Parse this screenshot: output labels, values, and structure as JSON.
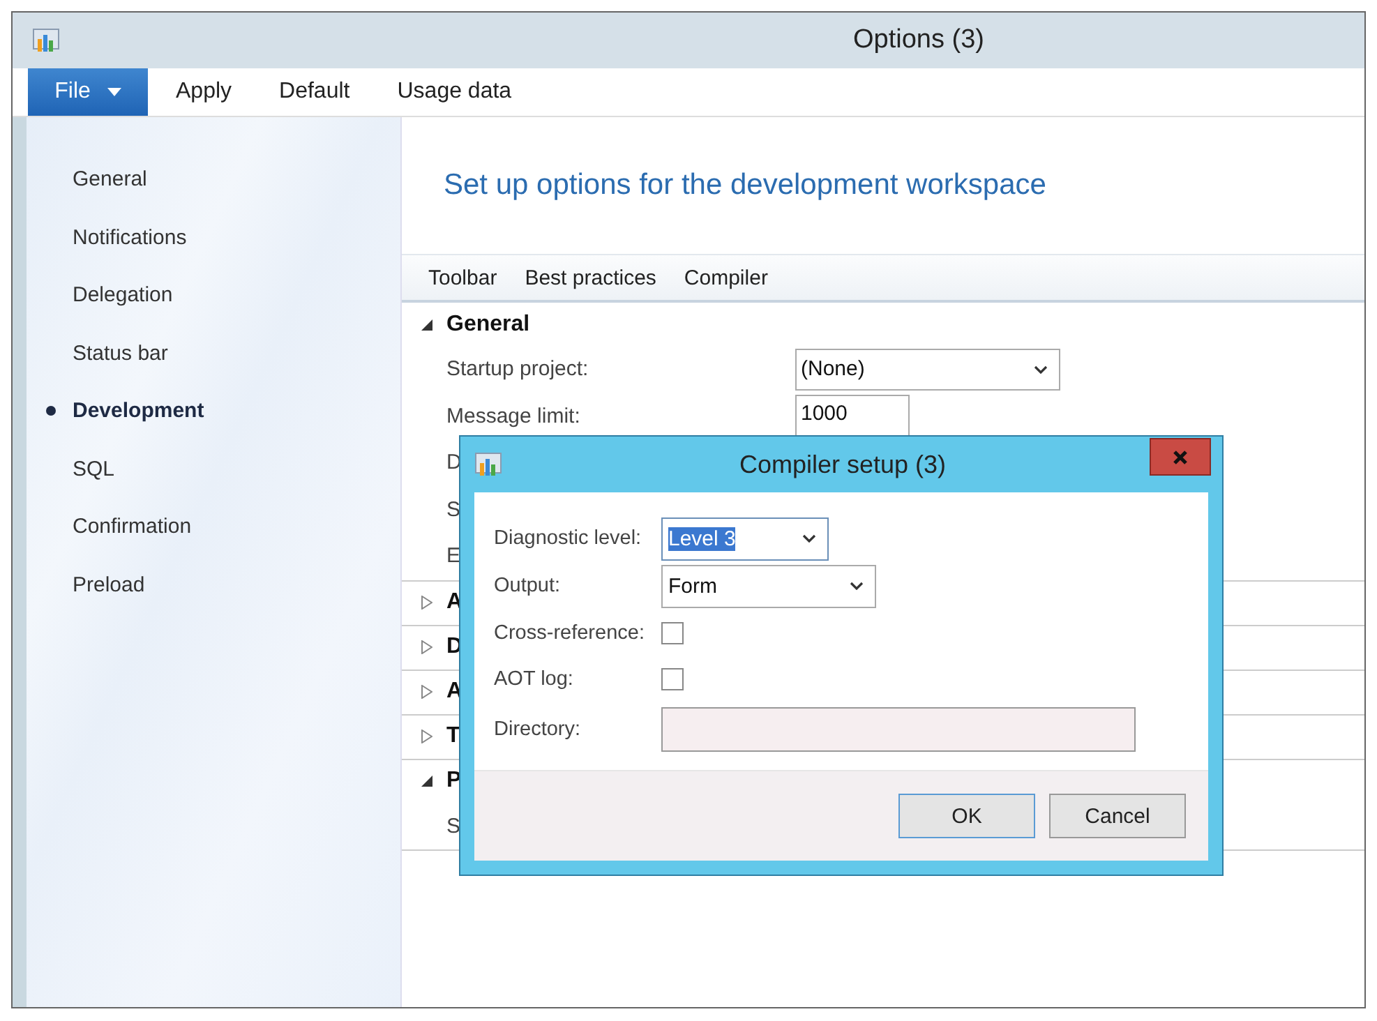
{
  "window": {
    "title": "Options (3)"
  },
  "menu": [
    {
      "label": "File",
      "kind": "dropdown"
    },
    {
      "label": "Apply",
      "kind": "plain"
    },
    {
      "label": "Default",
      "kind": "plain"
    },
    {
      "label": "Usage data",
      "kind": "plain"
    }
  ],
  "sidebar": {
    "items": [
      {
        "label": "General",
        "selected": false
      },
      {
        "label": "Notifications",
        "selected": false
      },
      {
        "label": "Delegation",
        "selected": false
      },
      {
        "label": "Status bar",
        "selected": false
      },
      {
        "label": "Development",
        "selected": true
      },
      {
        "label": "SQL",
        "selected": false
      },
      {
        "label": "Confirmation",
        "selected": false
      },
      {
        "label": "Preload",
        "selected": false
      }
    ]
  },
  "content": {
    "heading": "Set up options for the development workspace",
    "tabs": [
      "Toolbar",
      "Best practices",
      "Compiler"
    ],
    "sections": [
      {
        "title": "General",
        "expanded": true,
        "fields": [
          {
            "label": "Startup project:",
            "kind": "select",
            "value": "(None)"
          },
          {
            "label": "Message limit:",
            "kind": "input",
            "value": "1000"
          },
          {
            "label": "D",
            "kind": "text"
          },
          {
            "label": "S",
            "kind": "text"
          },
          {
            "label": "E",
            "kind": "text"
          }
        ]
      },
      {
        "title": "A",
        "expanded": false
      },
      {
        "title": "D",
        "expanded": false
      },
      {
        "title": "A",
        "expanded": false
      },
      {
        "title": "T",
        "expanded": false
      },
      {
        "title": "P",
        "expanded": true,
        "fields": [
          {
            "label": "S",
            "kind": "text"
          }
        ]
      }
    ]
  },
  "dialog": {
    "title": "Compiler setup (3)",
    "fields": [
      {
        "label": "Diagnostic level:",
        "kind": "select",
        "value": "Level 3",
        "text_selected": true
      },
      {
        "label": "Output:",
        "kind": "select",
        "value": "Form",
        "text_selected": false
      },
      {
        "label": "Cross-reference:",
        "kind": "checkbox",
        "checked": false
      },
      {
        "label": "AOT log:",
        "kind": "checkbox",
        "checked": false
      },
      {
        "label": "Directory:",
        "kind": "input",
        "disabled": true
      }
    ],
    "buttons": [
      {
        "label": "OK",
        "default": true
      },
      {
        "label": "Cancel",
        "default": false
      }
    ]
  }
}
